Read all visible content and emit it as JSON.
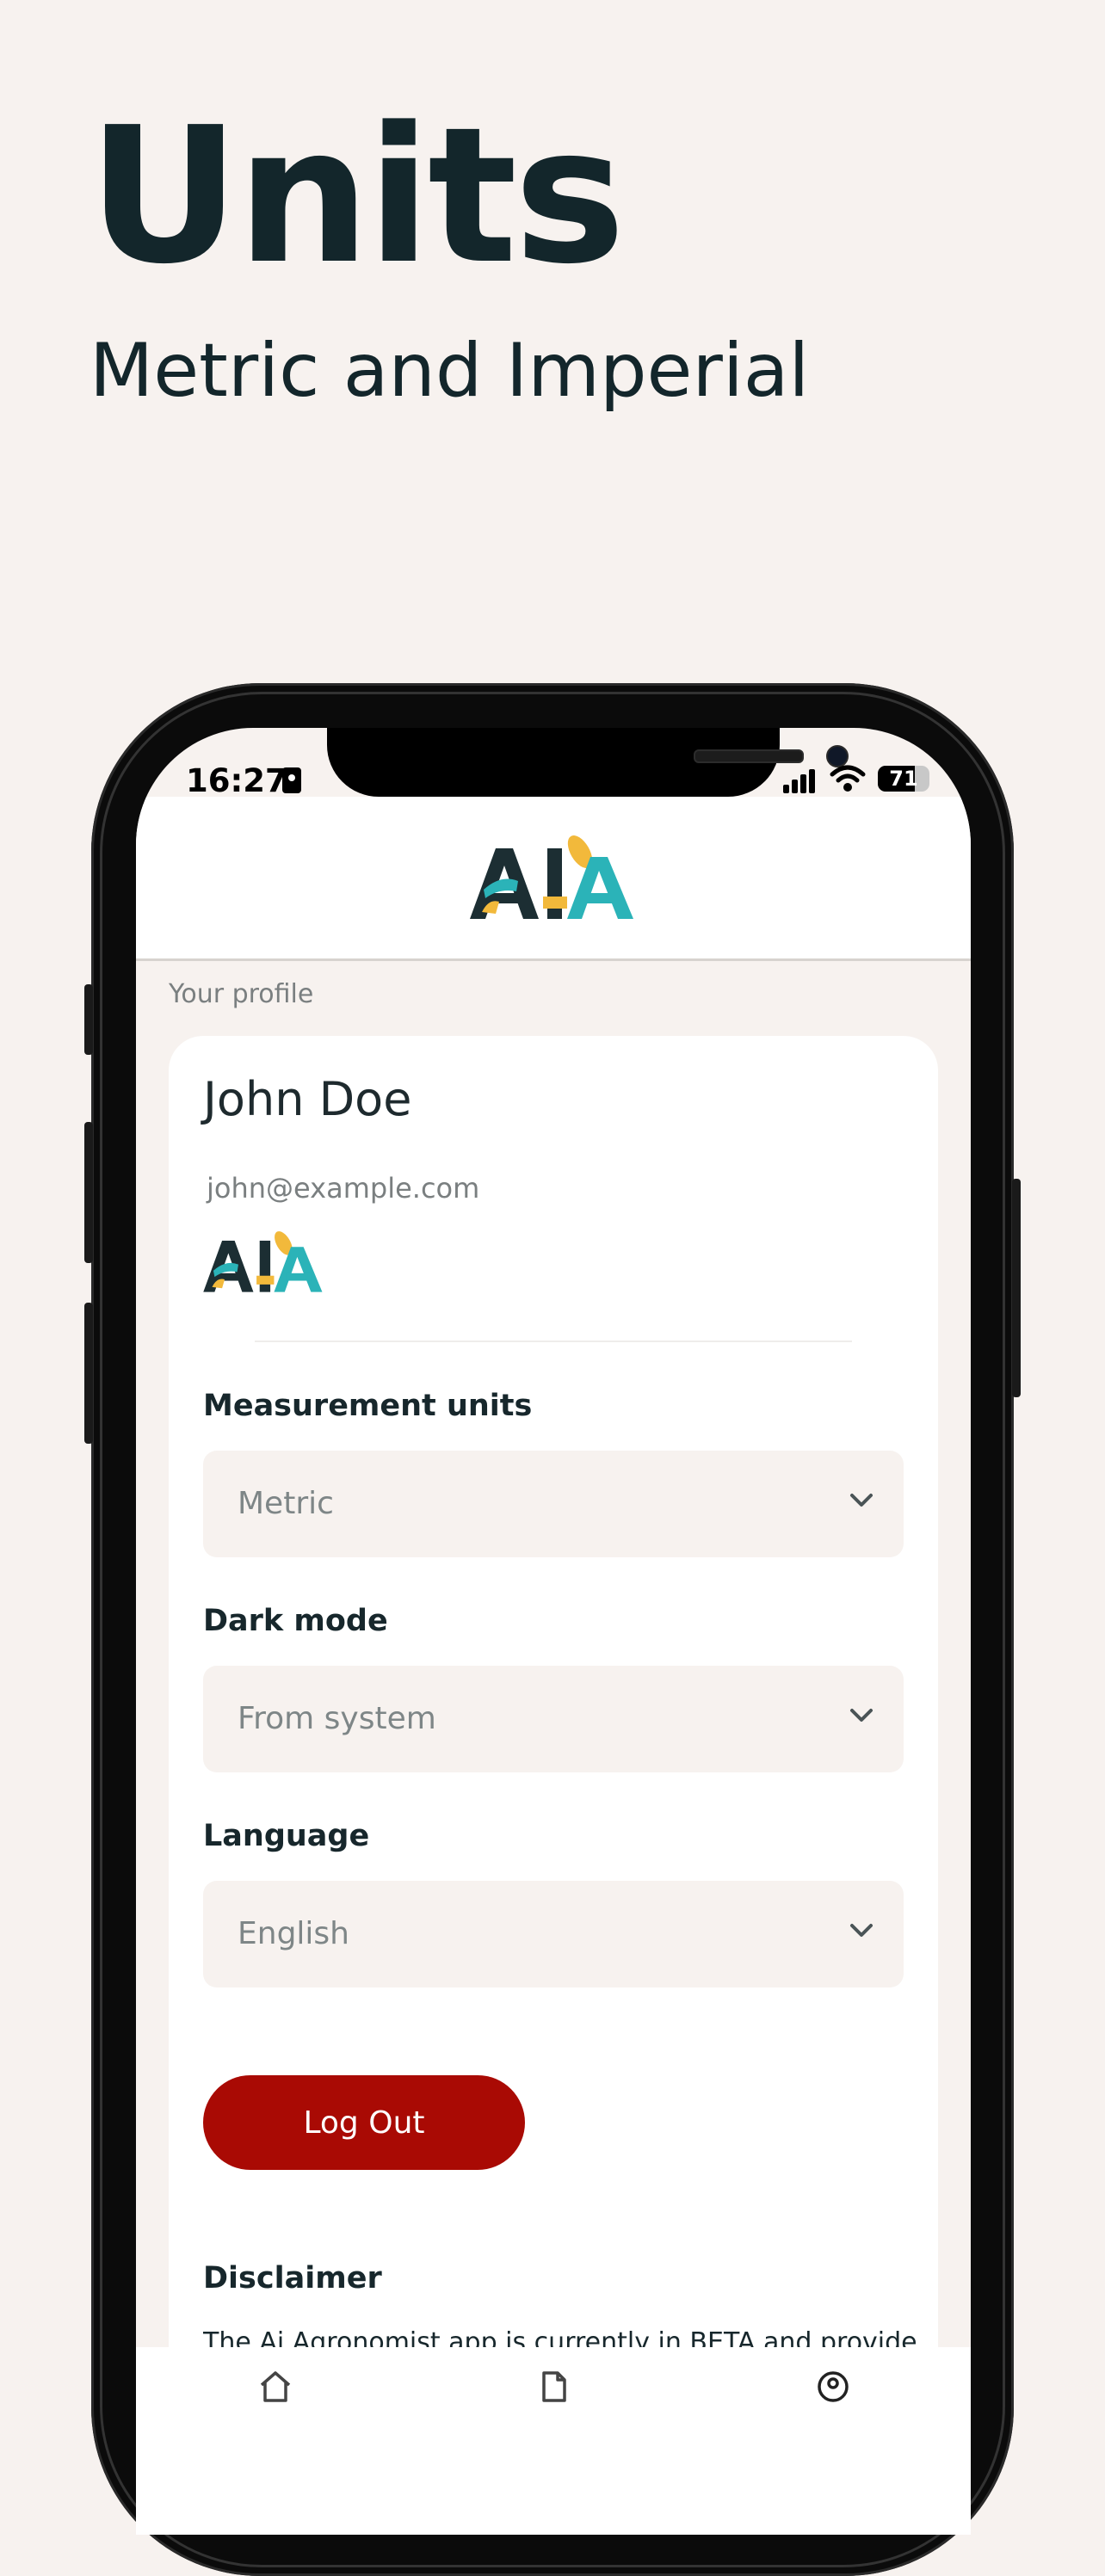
{
  "hero": {
    "title": "Units",
    "subtitle": "Metric and Imperial"
  },
  "status_bar": {
    "time": "16:27",
    "battery_level": "71",
    "battery_fraction": 0.71,
    "icons": [
      "id-card-icon",
      "cellular-signal-icon",
      "wifi-icon",
      "battery-icon"
    ]
  },
  "brand": {
    "logo_text": "AIA",
    "colors": {
      "dark": "#1c2e33",
      "teal": "#2bb3b8",
      "yellow": "#f2b93b",
      "accent_red": "#a90a04"
    }
  },
  "profile": {
    "section_label": "Your profile",
    "name": "John Doe",
    "email": "john@example.com"
  },
  "settings": {
    "measurement": {
      "label": "Measurement units",
      "value": "Metric"
    },
    "dark_mode": {
      "label": "Dark mode",
      "value": "From system"
    },
    "language": {
      "label": "Language",
      "value": "English"
    }
  },
  "actions": {
    "logout_label": "Log Out"
  },
  "disclaimer": {
    "title": "Disclaimer",
    "text": "The Ai Agronomist app is currently in BETA and provides"
  },
  "tab_bar": {
    "icons": [
      "home-icon",
      "document-icon",
      "profile-icon"
    ]
  }
}
